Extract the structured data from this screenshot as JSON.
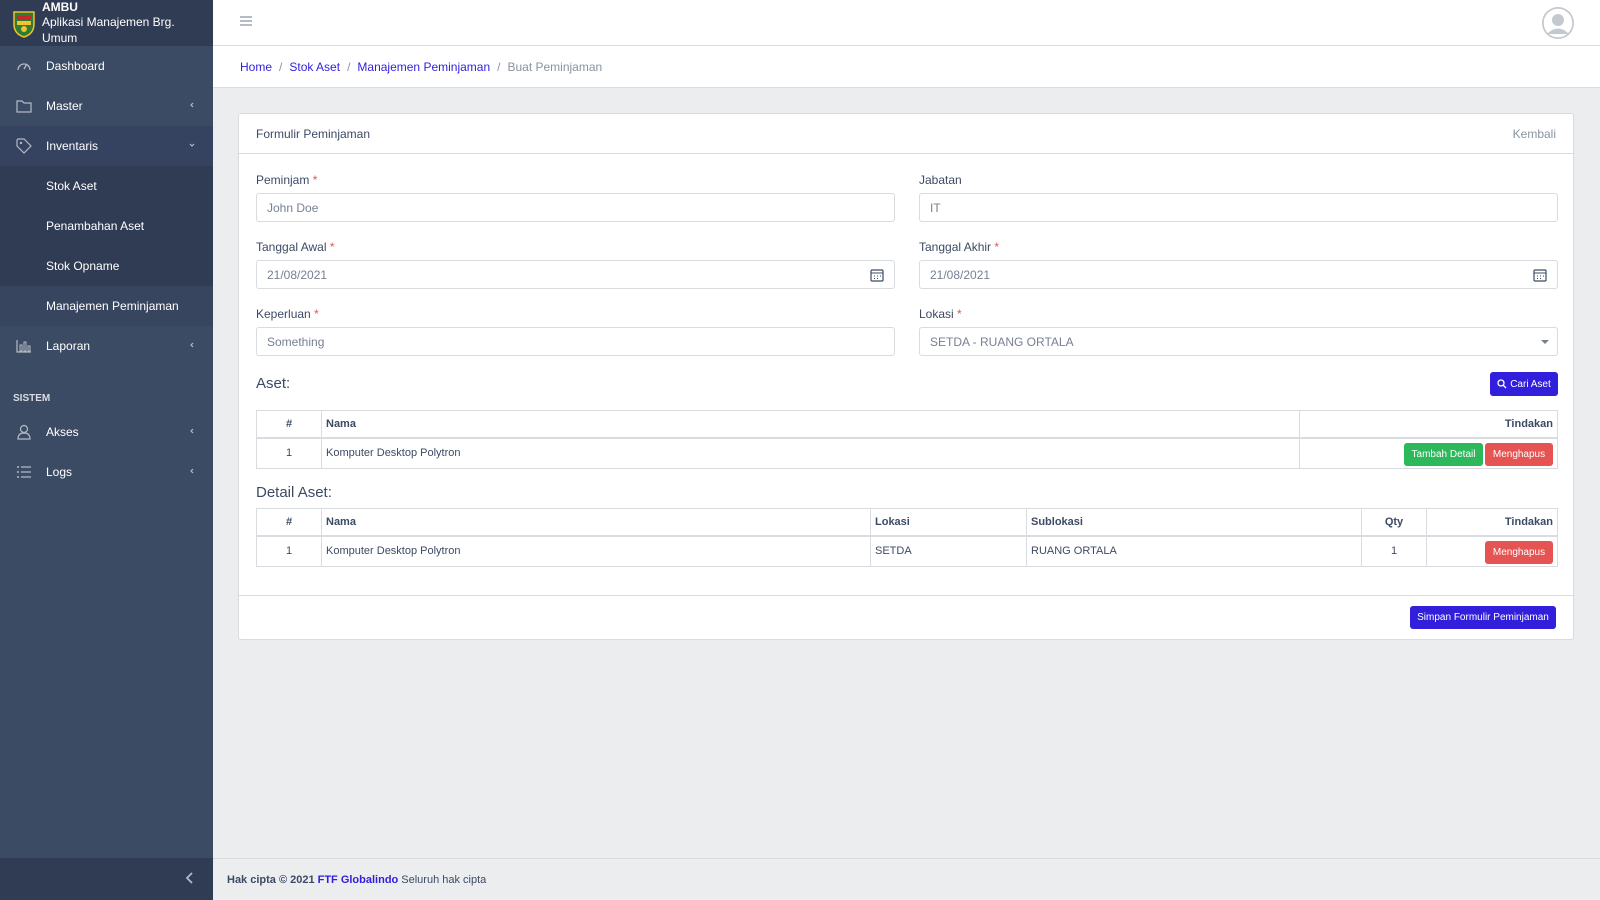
{
  "brand": {
    "name": "AMBU",
    "subtitle": "Aplikasi Manajemen Brg. Umum"
  },
  "sidebar": {
    "items": [
      {
        "label": "Dashboard",
        "icon": "speedometer-icon"
      },
      {
        "label": "Master",
        "icon": "folder-icon"
      },
      {
        "label": "Inventaris",
        "icon": "tag-icon"
      }
    ],
    "sub_items": [
      "Stok Aset",
      "Penambahan Aset",
      "Stok Opname",
      "Manajemen Peminjaman"
    ],
    "laporan": "Laporan",
    "section_title": "SISTEM",
    "system_items": [
      "Akses",
      "Logs"
    ]
  },
  "breadcrumb": [
    "Home",
    "Stok Aset",
    "Manajemen Peminjaman",
    "Buat Peminjaman"
  ],
  "form": {
    "title": "Formulir Peminjaman",
    "back": "Kembali",
    "peminjam": {
      "label": "Peminjam",
      "value": "John Doe"
    },
    "jabatan": {
      "label": "Jabatan",
      "value": "IT"
    },
    "tanggal_awal": {
      "label": "Tanggal Awal",
      "value": "21/08/2021"
    },
    "tanggal_akhir": {
      "label": "Tanggal Akhir",
      "value": "21/08/2021"
    },
    "keperluan": {
      "label": "Keperluan",
      "value": "Something"
    },
    "lokasi": {
      "label": "Lokasi",
      "value": "SETDA - RUANG ORTALA"
    },
    "required_mark": "*"
  },
  "aset": {
    "title": "Aset:",
    "search_button": "Cari Aset",
    "headers": [
      "#",
      "Nama",
      "Tindakan"
    ],
    "rows": [
      {
        "no": "1",
        "nama": "Komputer Desktop Polytron"
      }
    ],
    "add_detail": "Tambah Detail",
    "delete": "Menghapus"
  },
  "detail": {
    "title": "Detail Aset:",
    "headers": [
      "#",
      "Nama",
      "Lokasi",
      "Sublokasi",
      "Qty",
      "Tindakan"
    ],
    "rows": [
      {
        "no": "1",
        "nama": "Komputer Desktop Polytron",
        "lokasi": "SETDA",
        "sublokasi": "RUANG ORTALA",
        "qty": "1"
      }
    ],
    "delete": "Menghapus"
  },
  "save_button": "Simpan Formulir Peminjaman",
  "footer": {
    "prefix": "Hak cipta © 2021",
    "company": "FTF Globalindo",
    "suffix": "Seluruh hak cipta"
  },
  "colors": {
    "sidebar": "#3c4b64",
    "primary": "#321fdb",
    "success": "#2eb85c",
    "danger": "#e55353"
  }
}
